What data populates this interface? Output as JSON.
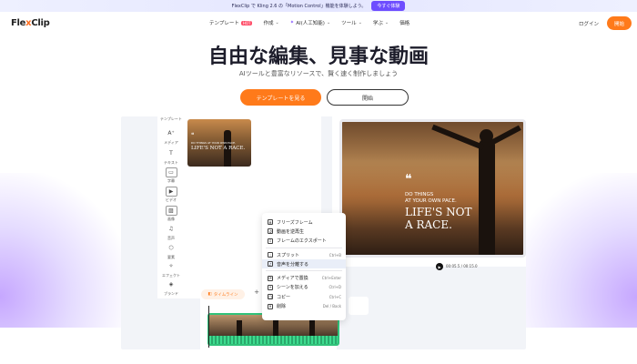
{
  "banner": {
    "text": "FlexClip で Kling 2.6 の「Motion Control」機能を体験しよう。",
    "button": "今すぐ体験"
  },
  "nav": {
    "logo_prefix": "Fle",
    "logo_x": "x",
    "logo_suffix": "Clip",
    "menu": [
      {
        "label": "テンプレート",
        "badge": "HOT"
      },
      {
        "label": "作成"
      },
      {
        "label": "AI(人工知能)"
      },
      {
        "label": "ツール"
      },
      {
        "label": "学ぶ"
      },
      {
        "label": "価格"
      }
    ],
    "login": "ログイン",
    "start": "開始"
  },
  "hero": {
    "title": "自由な編集、見事な動画",
    "subtitle": "AIツールと豊富なリソースで、賢く速く制作しましょう",
    "cta_primary": "テンプレートを見る",
    "cta_secondary": "開始"
  },
  "editor": {
    "sidebar": [
      "テンプレート",
      "メディア",
      "テキスト",
      "字幕",
      "ビデオ",
      "画像",
      "音声",
      "要素",
      "エフェクト",
      "ブランド"
    ],
    "sidebar_icons": [
      "template-icon",
      "media-icon",
      "text-icon",
      "subtitle-icon",
      "video-icon",
      "image-icon",
      "music-icon",
      "elements-icon",
      "effects-icon",
      "brand-icon"
    ],
    "thumb": {
      "quote": "❝",
      "line1": "DO THINGS AT YOUR OWN PACE.",
      "line2": "LIFE'S NOT A RACE."
    },
    "preview": {
      "quote": "❝",
      "line1a": "DO THINGS",
      "line1b": "AT YOUR OWN PACE.",
      "line2a": "LIFE'S NOT",
      "line2b": "A RACE."
    },
    "time": "00:05.5 / 00:15.0",
    "context_menu": [
      {
        "label": "フリーズフレーム",
        "shortcut": ""
      },
      {
        "label": "動画を逆再生",
        "shortcut": ""
      },
      {
        "label": "フレームのエクスポート",
        "shortcut": ""
      },
      {
        "label": "スプリット",
        "shortcut": "Ctrl+B"
      },
      {
        "label": "音声を分離する",
        "shortcut": ""
      },
      {
        "label": "メディアで置換",
        "shortcut": "Ctrl+Enter"
      },
      {
        "label": "シーンを加える",
        "shortcut": "Ctrl+D"
      },
      {
        "label": "コピー",
        "shortcut": "Ctrl+C"
      },
      {
        "label": "削除",
        "shortcut": "Del / Back"
      }
    ],
    "timeline_tab": "タイムライン"
  }
}
